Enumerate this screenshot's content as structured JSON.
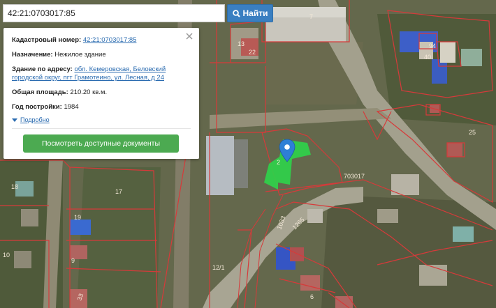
{
  "search": {
    "query": "42:21:0703017:85",
    "button_label": "Найти"
  },
  "popup": {
    "cadastral_label": "Кадастровый номер:",
    "cadastral_value": "42:21:0703017:85",
    "purpose_label": "Назначение:",
    "purpose_value": "Нежилое здание",
    "address_label": "Здание по адресу:",
    "address_value": "обл. Кемеровская, Беловский городской округ, пгт Грамотеино, ул. Лесная, д 24",
    "area_label": "Общая площадь:",
    "area_value": "210.20 кв.м.",
    "year_label": "Год постройки:",
    "year_value": "1984",
    "details_label": "Подробно",
    "docs_button_label": "Посмотреть доступные документы"
  },
  "map": {
    "quarter_label": "703017",
    "parcel_labels": [
      "7",
      "13",
      "22",
      "94",
      "40",
      "25",
      "2",
      "17",
      "18",
      "19",
      "9",
      "10",
      "12/1",
      "6",
      "33",
      "1033",
      "1265"
    ],
    "colors": {
      "parcel_border": "#d63a3a",
      "selected_fill": "#2fd14a",
      "marker": "#2e7fd6",
      "search_button": "#3a7fc1",
      "docs_button": "#4caa51"
    },
    "icons": [
      "search-icon",
      "close-icon",
      "map-marker-icon",
      "caret-down-icon"
    ]
  }
}
